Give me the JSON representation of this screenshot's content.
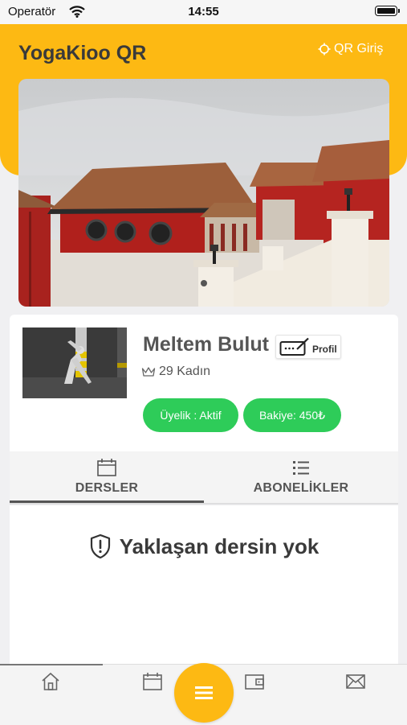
{
  "status_bar": {
    "carrier": "Operatör",
    "time": "14:55"
  },
  "header": {
    "title": "YogaKioo QR",
    "qr_login_label": "QR Giriş"
  },
  "banner": {
    "current_page": 1,
    "colors": {
      "brand": "#fdb913"
    }
  },
  "profile": {
    "name": "Meltem Bulut",
    "profile_button_label": "Profil",
    "meta": "29 Kadın",
    "membership_label": "Üyelik : Aktif",
    "balance_label": "Bakiye: 450₺"
  },
  "tabs": [
    {
      "label": "DERSLER",
      "icon": "calendar-icon",
      "active": true
    },
    {
      "label": "ABONELİKLER",
      "icon": "list-icon",
      "active": false
    }
  ],
  "empty_state": {
    "text": "Yaklaşan dersin yok",
    "icon": "shield-alert-icon"
  },
  "bottom_nav": {
    "items": [
      "home-icon",
      "calendar-icon",
      "menu-icon",
      "wallet-icon",
      "mail-icon"
    ],
    "active_index": 0
  },
  "colors": {
    "accent": "#fdb913",
    "success": "#2ecc59"
  }
}
